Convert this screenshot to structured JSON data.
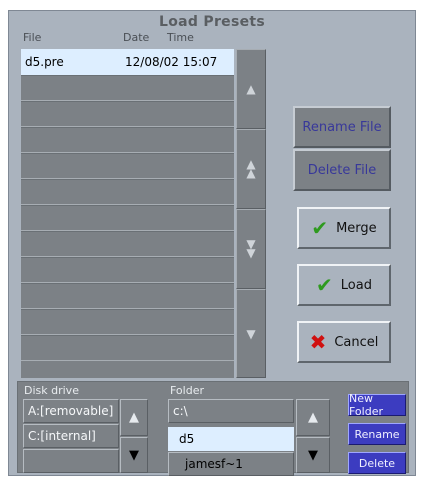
{
  "dialog": {
    "title": "Load Presets",
    "columns": {
      "file": "File",
      "date": "Date",
      "time": "Time"
    }
  },
  "file_list": {
    "rows": [
      {
        "name": "d5.pre",
        "datetime": "12/08/02 15:07",
        "selected": true
      },
      {
        "name": "",
        "datetime": ""
      },
      {
        "name": "",
        "datetime": ""
      },
      {
        "name": "",
        "datetime": ""
      },
      {
        "name": "",
        "datetime": ""
      },
      {
        "name": "",
        "datetime": ""
      },
      {
        "name": "",
        "datetime": ""
      },
      {
        "name": "",
        "datetime": ""
      },
      {
        "name": "",
        "datetime": ""
      },
      {
        "name": "",
        "datetime": ""
      },
      {
        "name": "",
        "datetime": ""
      },
      {
        "name": "",
        "datetime": ""
      }
    ],
    "scroll_icons": [
      "scroll-up-icon",
      "page-up-icon",
      "page-down-icon",
      "scroll-down-icon"
    ]
  },
  "actions": {
    "rename_file": "Rename File",
    "delete_file": "Delete File",
    "merge": "Merge",
    "load": "Load",
    "cancel": "Cancel"
  },
  "disk": {
    "label": "Disk drive",
    "items": [
      "A:[removable]",
      "C:[internal]",
      ""
    ]
  },
  "folder": {
    "label": "Folder",
    "path": "c:\\",
    "items": [
      "d5",
      "jamesf~1"
    ],
    "selected_index": 0
  },
  "folder_buttons": {
    "new_folder": "New Folder",
    "rename": "Rename",
    "delete": "Delete"
  },
  "colors": {
    "panel": "#aab3be",
    "list": "#7c8186",
    "selection": "#ddeeff",
    "blue_button": "#3c3cc0",
    "check": "#2e9a1e",
    "cross": "#d01010"
  }
}
